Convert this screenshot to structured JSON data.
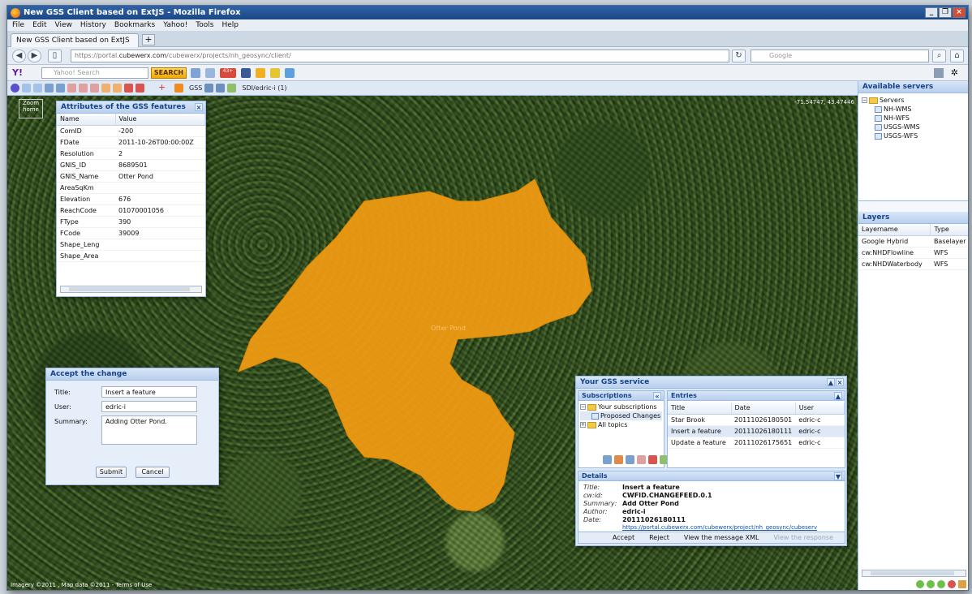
{
  "browser": {
    "title": "New GSS Client based on ExtJS - Mozilla Firefox",
    "menu": [
      "File",
      "Edit",
      "View",
      "History",
      "Bookmarks",
      "Yahoo!",
      "Tools",
      "Help"
    ],
    "tab_title": "New GSS Client based on ExtJS",
    "url_prefix": "https://portal.",
    "url_domain": "cubewerx.com",
    "url_path": "/cubewerx/projects/nh_geosync/client/",
    "search_engine_placeholder": "Google",
    "yahoo_label": "Y!",
    "yahoo_search_placeholder": "Yahoo! Search",
    "yahoo_search_button": "SEARCH",
    "mail_count": "43+"
  },
  "toolbar": {
    "gss_label": "GSS",
    "sdi_label": "SDI/edric-i (1)"
  },
  "map": {
    "coords": "-71.54747, 43.47446",
    "zoom_label": "Zoom home",
    "feature_label": "Otter Pond",
    "footer": "Imagery ©2011 , Map data ©2011 - Terms of Use",
    "colors": {
      "polygon": "#f39c12",
      "forest": "#35531f"
    }
  },
  "attributes": {
    "title": "Attributes of the GSS features",
    "headers": [
      "Name",
      "Value"
    ],
    "rows": [
      [
        "ComID",
        "-200"
      ],
      [
        "FDate",
        "2011-10-26T00:00:00Z"
      ],
      [
        "Resolution",
        "2"
      ],
      [
        "GNIS_ID",
        "8689501"
      ],
      [
        "GNIS_Name",
        "Otter Pond"
      ],
      [
        "AreaSqKm",
        ""
      ],
      [
        "Elevation",
        "676"
      ],
      [
        "ReachCode",
        "01070001056"
      ],
      [
        "FType",
        "390"
      ],
      [
        "FCode",
        "39009"
      ],
      [
        "Shape_Leng",
        ""
      ],
      [
        "Shape_Area",
        ""
      ]
    ]
  },
  "accept": {
    "title": "Accept the change",
    "title_label": "Title:",
    "title_value": "Insert a feature",
    "user_label": "User:",
    "user_value": "edric-i",
    "summary_label": "Summary:",
    "summary_value": "Adding Otter Pond.",
    "submit": "Submit",
    "cancel": "Cancel"
  },
  "gss": {
    "title": "Your GSS service",
    "subscriptions_title": "Subscriptions",
    "tree": [
      "Your subscriptions",
      "Proposed Changes",
      "All topics"
    ],
    "entries_title": "Entries",
    "entry_headers": [
      "Title",
      "Date",
      "User"
    ],
    "entries": [
      [
        "Star Brook",
        "20111026180501",
        "edric-c"
      ],
      [
        "Insert a feature",
        "20111026180111",
        "edric-c"
      ],
      [
        "Update a feature",
        "20111026175651",
        "edric-c"
      ]
    ],
    "details_title": "Details",
    "details": [
      [
        "Title:",
        "Insert a feature"
      ],
      [
        "cw:id:",
        "CWFID.CHANGEFEED.0.1"
      ],
      [
        "Summary:",
        "Add Otter Pond"
      ],
      [
        "Author:",
        "edric-i"
      ],
      [
        "Date:",
        "20111026180111"
      ]
    ],
    "details_link": "https://portal.cubewerx.com/cubewerx/project/nh_geosync/cubeserv",
    "actions": [
      "Accept",
      "Reject",
      "View the message XML",
      "View the response"
    ]
  },
  "servers": {
    "title": "Available servers",
    "root": "Servers",
    "items": [
      "NH-WMS",
      "NH-WFS",
      "USGS-WMS",
      "USGS-WFS"
    ]
  },
  "layers": {
    "title": "Layers",
    "headers": [
      "Layername",
      "Type"
    ],
    "rows": [
      [
        "Google Hybrid",
        "Baselayer"
      ],
      [
        "cw:NHDFlowline",
        "WFS"
      ],
      [
        "cw:NHDWaterbody",
        "WFS"
      ]
    ]
  }
}
